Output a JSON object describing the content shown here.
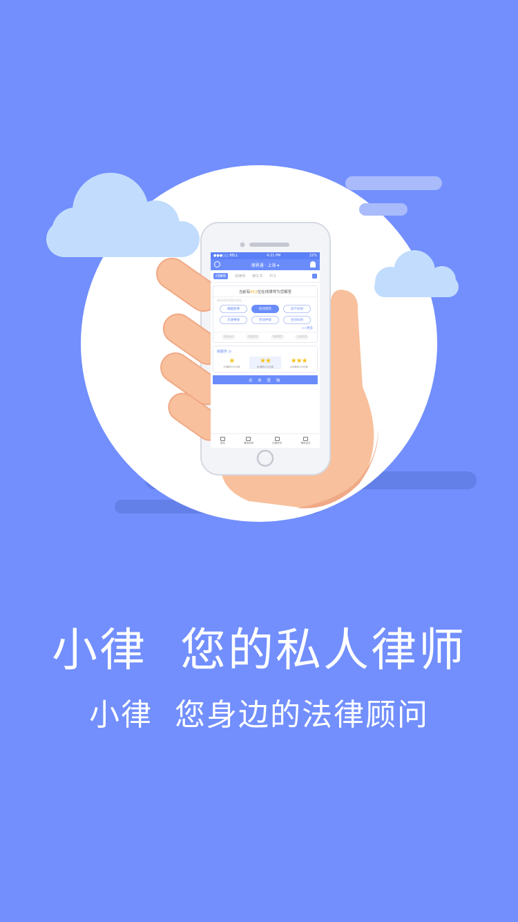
{
  "colors": {
    "background": "#728ffd",
    "accent": "#6a8cfb",
    "circle": "#ffffff",
    "cloud": "#c2dcfd",
    "skin": "#f8c09c",
    "star": "#f8c21b"
  },
  "phone": {
    "status": {
      "carrier": "●●●○○ BELL",
      "time": "4:21 PM",
      "battery": "22%"
    },
    "nav_title": "律界通 · 上海 ▾",
    "tabs": [
      "问律师",
      "找律师",
      "律文书",
      "TCS"
    ],
    "online_prefix": "当前有",
    "online_count": "652",
    "online_suffix": "位在线律师为您解答",
    "hint": "请选择您的案件类型",
    "tags": [
      "婚姻家事",
      "民间借贷",
      "房产纠纷",
      "交通事故",
      "劳动仲裁",
      "合同纠纷"
    ],
    "more": ">>更多",
    "subtags": [
      "劳动纠纷",
      "债权债务",
      "刑事辩护",
      "公司法务"
    ],
    "service_title": "级服务 ◷",
    "tiers": [
      {
        "stars": "★",
        "price": "30律币/15分钟"
      },
      {
        "stars": "★★",
        "price": "60律币/15分钟"
      },
      {
        "stars": "★★★",
        "price": "200律币/15分钟"
      }
    ],
    "cta": "点 击 咨 询",
    "bottom_nav": [
      "咨询",
      "律师查询",
      "法律资讯",
      "律师说法"
    ]
  },
  "headline": "小律  您的私人律师",
  "subline": "小律  您身边的法律顾问"
}
